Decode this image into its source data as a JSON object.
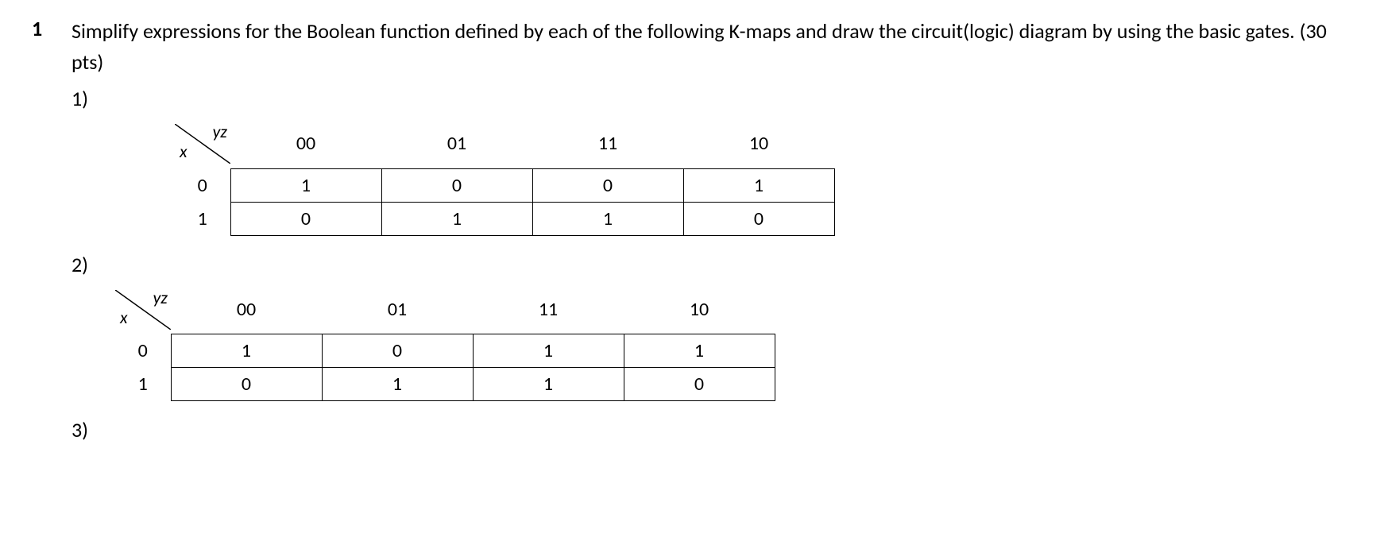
{
  "question": {
    "number": "1",
    "text": "Simplify expressions for the Boolean function defined by each of the following K-maps and draw the circuit(logic) diagram by using the basic gates. (30 pts)"
  },
  "subparts": [
    "1)",
    "2)",
    "3)"
  ],
  "kmap_labels": {
    "row_var": "x",
    "col_var": "yz",
    "col_headers": [
      "00",
      "01",
      "11",
      "10"
    ],
    "row_headers": [
      "0",
      "1"
    ]
  },
  "chart_data": [
    {
      "type": "table",
      "title": "K-map 1",
      "row_variable": "x",
      "col_variable": "yz",
      "columns": [
        "00",
        "01",
        "11",
        "10"
      ],
      "rows": [
        "0",
        "1"
      ],
      "values": [
        [
          "1",
          "0",
          "0",
          "1"
        ],
        [
          "0",
          "1",
          "1",
          "0"
        ]
      ]
    },
    {
      "type": "table",
      "title": "K-map 2",
      "row_variable": "x",
      "col_variable": "yz",
      "columns": [
        "00",
        "01",
        "11",
        "10"
      ],
      "rows": [
        "0",
        "1"
      ],
      "values": [
        [
          "1",
          "0",
          "1",
          "1"
        ],
        [
          "0",
          "1",
          "1",
          "0"
        ]
      ]
    }
  ]
}
